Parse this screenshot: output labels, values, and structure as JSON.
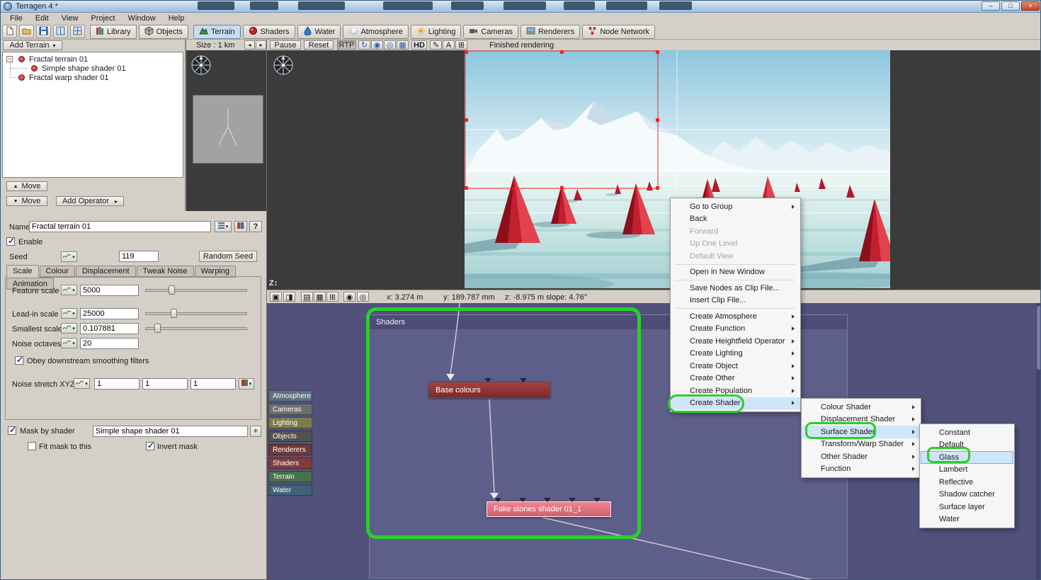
{
  "window": {
    "title": "Terragen 4 *"
  },
  "icons": {
    "minimize": "–",
    "maximize": "□",
    "close": "×",
    "dropdown": "▾",
    "up_arrow": "▲",
    "down_arrow": "▼",
    "left_arrow": "◂",
    "right_arrow": "▸",
    "check": "✓",
    "help": "?",
    "add": "+",
    "refresh": "↻",
    "pencil": "✎",
    "zoom": "Z",
    "updown": "↕",
    "eye": "◉",
    "grid": "▦",
    "layers": "▤",
    "camera": "▣",
    "photo": "◨",
    "target": "◎",
    "letter_a": "A",
    "hash": "⊞",
    "minus": "−"
  },
  "menubar": {
    "items": [
      "File",
      "Edit",
      "View",
      "Project",
      "Window",
      "Help"
    ]
  },
  "toolbar": {
    "library": "Library",
    "objects": "Objects",
    "tabs": [
      {
        "label": "Terrain"
      },
      {
        "label": "Shaders"
      },
      {
        "label": "Water"
      },
      {
        "label": "Atmosphere"
      },
      {
        "label": "Lighting"
      },
      {
        "label": "Cameras"
      },
      {
        "label": "Renderers"
      },
      {
        "label": "Node Network"
      }
    ]
  },
  "terrain_panel": {
    "add_terrain": "Add Terrain",
    "tree": [
      "Fractal terrain 01",
      "Simple shape shader 01",
      "Fractal warp shader 01"
    ],
    "move_label": "Move",
    "add_operator": "Add Operator"
  },
  "properties": {
    "name_label": "Name",
    "name_value": "Fractal terrain 01",
    "enable_label": "Enable",
    "seed_label": "Seed",
    "seed_value": "119",
    "random_seed_label": "Random Seed",
    "tabs": [
      "Scale",
      "Colour",
      "Displacement",
      "Tweak Noise",
      "Warping",
      "Animation"
    ],
    "feature_scale": {
      "label": "Feature scale",
      "value": "5000"
    },
    "leadin_scale": {
      "label": "Lead-in scale",
      "value": "25000"
    },
    "smallest_scale": {
      "label": "Smallest scale",
      "value": "0.107881"
    },
    "noise_octaves": {
      "label": "Noise octaves",
      "value": "20"
    },
    "obey_label": "Obey downstream smoothing filters",
    "noise_stretch": {
      "label": "Noise stretch XYZ",
      "x": "1",
      "y": "1",
      "z": "1"
    },
    "mask": {
      "label": "Mask by shader",
      "value": "Simple shape shader 01",
      "fit_label": "Fit mask to this",
      "invert_label": "Invert mask"
    }
  },
  "preview_bar": {
    "size_label": "Size : 1 km",
    "pause": "Pause",
    "reset": "Reset",
    "rtp": "RTP",
    "hd": "HD",
    "status": "Finished rendering"
  },
  "status_bar": {
    "x": "x: 3.274 m",
    "y": "y: 189.787 mm",
    "z": "z: -8.975 m",
    "slope": "slope: 4.76°"
  },
  "node_network": {
    "group_title": "Shaders",
    "categories": [
      "Atmosphere",
      "Cameras",
      "Lighting",
      "Objects",
      "Renderers",
      "Shaders",
      "Terrain",
      "Water"
    ],
    "nodes": {
      "base_colours": "Base colours",
      "fake_stones": "Fake stones shader 01_1"
    }
  },
  "context_menu": {
    "items": [
      {
        "label": "Go to Group",
        "enabled": true,
        "submenu": true
      },
      {
        "label": "Back",
        "enabled": true,
        "submenu": false
      },
      {
        "label": "Forward",
        "enabled": false,
        "submenu": false
      },
      {
        "label": "Up One Level",
        "enabled": false,
        "submenu": false
      },
      {
        "label": "Default View",
        "enabled": false,
        "submenu": false
      },
      {
        "label": "Open in New Window",
        "enabled": true,
        "submenu": false
      },
      {
        "label": "Save Nodes as Clip File...",
        "enabled": true,
        "submenu": false
      },
      {
        "label": "Insert Clip File...",
        "enabled": true,
        "submenu": false
      },
      {
        "label": "Create Atmosphere",
        "enabled": true,
        "submenu": true
      },
      {
        "label": "Create Function",
        "enabled": true,
        "submenu": true
      },
      {
        "label": "Create Heightfield Operator",
        "enabled": true,
        "submenu": true
      },
      {
        "label": "Create Lighting",
        "enabled": true,
        "submenu": true
      },
      {
        "label": "Create Object",
        "enabled": true,
        "submenu": true
      },
      {
        "label": "Create Other",
        "enabled": true,
        "submenu": true
      },
      {
        "label": "Create Population",
        "enabled": true,
        "submenu": true
      },
      {
        "label": "Create Shader",
        "enabled": true,
        "submenu": true,
        "highlighted": true
      }
    ]
  },
  "shader_submenu": {
    "items": [
      {
        "label": "Colour Shader",
        "submenu": true
      },
      {
        "label": "Displacement Shader",
        "submenu": true
      },
      {
        "label": "Surface Shader",
        "submenu": true,
        "highlighted": true
      },
      {
        "label": "Transform/Warp Shader",
        "submenu": true
      },
      {
        "label": "Other Shader",
        "submenu": true
      },
      {
        "label": "Function",
        "submenu": true
      }
    ]
  },
  "surface_submenu": {
    "items": [
      {
        "label": "Constant"
      },
      {
        "label": "Default"
      },
      {
        "label": "Glass",
        "highlighted": true
      },
      {
        "label": "Lambert"
      },
      {
        "label": "Reflective"
      },
      {
        "label": "Shadow catcher"
      },
      {
        "label": "Surface layer"
      },
      {
        "label": "Water"
      }
    ]
  },
  "colors": {
    "annotation_green": "#27d127",
    "menu_highlight": "#cfe5f8",
    "menu_highlight_border": "#7ab0e0",
    "node_network_bg": "#51517c",
    "group_bg": "#5e5e8a",
    "group_header_bg": "#4c4c77",
    "node_red": "#9a3535",
    "node_pink": "#e2707c",
    "tab_active": "#c7dcee",
    "titlebar_top": "#d9e7f5",
    "cone_red": "#c21f2f"
  }
}
